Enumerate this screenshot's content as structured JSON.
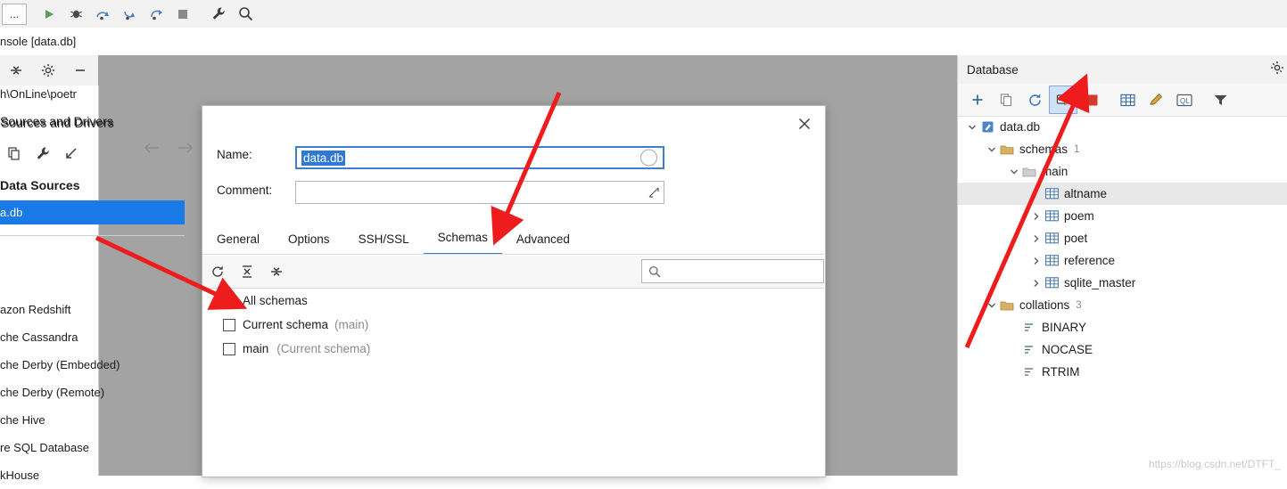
{
  "toolbar": {
    "menu_button": "...",
    "buttons": [
      {
        "name": "run-icon",
        "glyph": "▶"
      },
      {
        "name": "debug-icon",
        "glyph": "bug"
      },
      {
        "name": "step-over-icon",
        "glyph": "arc-right"
      },
      {
        "name": "step-into-icon",
        "glyph": "arc-down"
      },
      {
        "name": "step-out-icon",
        "glyph": "arc-up"
      },
      {
        "name": "stop-icon",
        "glyph": "■"
      },
      {
        "name": "wrench-icon",
        "glyph": "wrench"
      },
      {
        "name": "search-icon",
        "glyph": "magnifier"
      }
    ]
  },
  "console": {
    "tab_label": "nsole [data.db]"
  },
  "left_panel": {
    "toolstrip": [
      "expand-all-icon",
      "settings-icon",
      "minimize-icon"
    ],
    "path": "h\\OnLine\\poetr",
    "dialog_title_fragment": "Sources and Drivers",
    "toolbar_icons": [
      "copy-icon",
      "wrench-icon",
      "import-icon"
    ],
    "nav": [
      "back-arrow-icon",
      "forward-arrow-icon"
    ],
    "section_header": "Data Sources",
    "selected_item": "a.db",
    "driver_list": [
      "azon Redshift",
      "che Cassandra",
      "che Derby (Embedded)",
      "che Derby (Remote)",
      "che Hive",
      "re SQL Database",
      "kHouse"
    ]
  },
  "dialog": {
    "title": "Sources and Drivers",
    "close_label": "✕",
    "name_label": "Name:",
    "name_value": "data.db",
    "comment_label": "Comment:",
    "comment_value": "",
    "tabs": [
      {
        "label": "General",
        "active": false
      },
      {
        "label": "Options",
        "active": false
      },
      {
        "label": "SSH/SSL",
        "active": false
      },
      {
        "label": "Schemas",
        "active": true
      },
      {
        "label": "Advanced",
        "active": false
      }
    ],
    "schema_toolbar": [
      "refresh-icon",
      "collapse-icon",
      "expand-icon"
    ],
    "search_placeholder": "",
    "schemas": [
      {
        "label": "All schemas",
        "note": "",
        "checked": true,
        "indent": 0
      },
      {
        "label": "Current schema",
        "note": "(main)",
        "checked": false,
        "indent": 1
      },
      {
        "label": "main",
        "note": "(Current schema)",
        "checked": false,
        "indent": 1
      }
    ]
  },
  "database_panel": {
    "title": "Database",
    "toolbar": [
      {
        "name": "add-icon",
        "glyph": "+"
      },
      {
        "name": "copy-icon",
        "glyph": "copy"
      },
      {
        "name": "refresh-icon",
        "glyph": "refresh"
      },
      {
        "name": "edit-data-source-icon",
        "glyph": "edit-source",
        "selected": true
      },
      {
        "name": "stop-icon",
        "glyph": "stop"
      },
      {
        "name": "table-icon",
        "glyph": "table"
      },
      {
        "name": "modify-icon",
        "glyph": "pencil"
      },
      {
        "name": "sql-console-icon",
        "glyph": "ql"
      },
      {
        "name": "filter-icon",
        "glyph": "funnel"
      }
    ],
    "tree": [
      {
        "label": "data.db",
        "indent": 0,
        "twisty": "down",
        "icon": "datasource-icon",
        "count": ""
      },
      {
        "label": "schemas",
        "indent": 1,
        "twisty": "down",
        "icon": "folder-icon",
        "count": "1"
      },
      {
        "label": "main",
        "indent": 2,
        "twisty": "down",
        "icon": "schema-icon",
        "count": ""
      },
      {
        "label": "altname",
        "indent": 3,
        "twisty": "none",
        "icon": "table-icon",
        "count": "",
        "selected": true
      },
      {
        "label": "poem",
        "indent": 3,
        "twisty": "right",
        "icon": "table-icon",
        "count": ""
      },
      {
        "label": "poet",
        "indent": 3,
        "twisty": "right",
        "icon": "table-icon",
        "count": ""
      },
      {
        "label": "reference",
        "indent": 3,
        "twisty": "right",
        "icon": "table-icon",
        "count": ""
      },
      {
        "label": "sqlite_master",
        "indent": 3,
        "twisty": "right",
        "icon": "table-icon",
        "count": ""
      },
      {
        "label": "collations",
        "indent": 1,
        "twisty": "down",
        "icon": "folder-icon",
        "count": "3"
      },
      {
        "label": "BINARY",
        "indent": 2,
        "twisty": "none",
        "icon": "collation-icon",
        "count": ""
      },
      {
        "label": "NOCASE",
        "indent": 2,
        "twisty": "none",
        "icon": "collation-icon",
        "count": ""
      },
      {
        "label": "RTRIM",
        "indent": 2,
        "twisty": "none",
        "icon": "collation-icon",
        "count": ""
      }
    ],
    "watermark": "https://blog.csdn.net/DTFT_"
  },
  "colors": {
    "accent": "#3d7ecf",
    "selection": "#1a7ae8",
    "arrow": "#ee1c1c",
    "gray_editor": "#a3a3a3"
  }
}
